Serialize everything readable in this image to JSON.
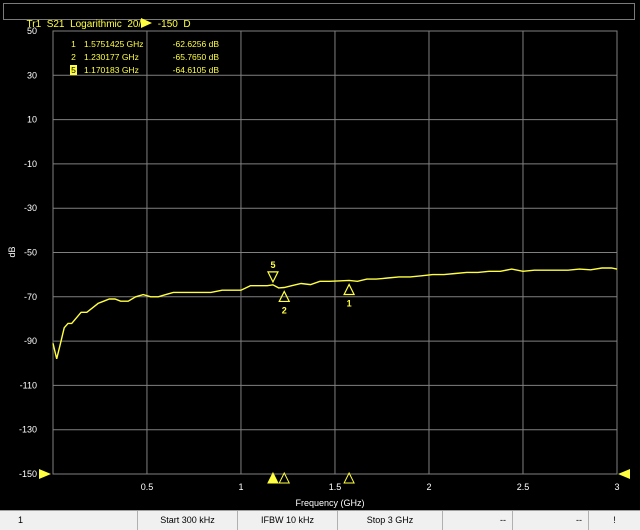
{
  "trace": {
    "name": "Tr1",
    "measurement": "S21",
    "format": "Logarithmic",
    "scale_div": "20",
    "reference": "-150",
    "d_label": "D"
  },
  "marker_table": [
    {
      "index": "1",
      "freq": "1.5751425 GHz",
      "value": "-62.6256 dB",
      "active": false
    },
    {
      "index": "2",
      "freq": "1.230177 GHz",
      "value": "-65.7650 dB",
      "active": false
    },
    {
      "index": "5",
      "freq": "1.170183 GHz",
      "value": "-64.6105 dB",
      "active": true
    }
  ],
  "status_bar": {
    "channel": "1",
    "start": "Start 300 kHz",
    "ifbw": "IFBW 10 kHz",
    "stop": "Stop 3 GHz",
    "field1": "--",
    "field2": "--",
    "field3": "!"
  },
  "colors": {
    "trace": "#ffff40",
    "grid": "#808080",
    "background": "#000000"
  },
  "chart_data": {
    "type": "line",
    "title": "",
    "xlabel": "Frequency (GHz)",
    "ylabel": "dB",
    "xlim": [
      0.0003,
      3
    ],
    "ylim": [
      -150,
      50
    ],
    "x_ticks": [
      0.5,
      1,
      1.5,
      2,
      2.5,
      3
    ],
    "x_tick_labels": [
      "0.5",
      "1",
      "1.5",
      "2",
      "2.5",
      "3"
    ],
    "y_ticks": [
      50,
      30,
      10,
      -10,
      -30,
      -50,
      -70,
      -90,
      -110,
      -130,
      -150
    ],
    "y_tick_labels": [
      "50",
      "30",
      "10",
      "-10",
      "-30",
      "-50",
      "-70",
      "-90",
      "-110",
      "-130",
      "-150"
    ],
    "grid": true,
    "series": [
      {
        "x": [
          0.0003,
          0.02,
          0.04,
          0.06,
          0.08,
          0.1,
          0.12,
          0.15,
          0.18,
          0.21,
          0.24,
          0.27,
          0.3,
          0.33,
          0.36,
          0.4,
          0.44,
          0.48,
          0.52,
          0.56,
          0.6,
          0.64,
          0.68,
          0.72,
          0.78,
          0.84,
          0.9,
          0.96,
          1.0,
          1.05,
          1.1,
          1.14,
          1.17,
          1.2,
          1.23,
          1.27,
          1.32,
          1.37,
          1.42,
          1.47,
          1.52,
          1.575,
          1.62,
          1.67,
          1.72,
          1.78,
          1.84,
          1.9,
          1.96,
          2.02,
          2.08,
          2.14,
          2.2,
          2.26,
          2.32,
          2.38,
          2.44,
          2.5,
          2.56,
          2.62,
          2.68,
          2.74,
          2.8,
          2.86,
          2.92,
          2.97,
          3.0
        ],
        "y": [
          -91,
          -98,
          -91,
          -84,
          -82,
          -82,
          -80,
          -77,
          -77,
          -75,
          -73,
          -72,
          -71,
          -71,
          -72,
          -72,
          -70,
          -69,
          -70,
          -70,
          -69,
          -68,
          -68,
          -68,
          -68,
          -68,
          -67,
          -67,
          -67,
          -65,
          -65,
          -65,
          -64.6,
          -66,
          -65.8,
          -65,
          -64,
          -64.5,
          -63,
          -63,
          -62.8,
          -62.6,
          -63,
          -62,
          -62,
          -61.5,
          -61,
          -61,
          -60.5,
          -60,
          -60,
          -59.5,
          -59,
          -59,
          -58.5,
          -58.5,
          -57.5,
          -58.5,
          -58,
          -58,
          -58,
          -58,
          -57.5,
          -57.8,
          -57,
          -57,
          -57.5
        ]
      }
    ],
    "markers": [
      {
        "label": "1",
        "x": 1.5751425,
        "y": -62.6256,
        "orientation": "up",
        "active": false
      },
      {
        "label": "2",
        "x": 1.230177,
        "y": -65.765,
        "orientation": "up",
        "active": false
      },
      {
        "label": "5",
        "x": 1.170183,
        "y": -64.6105,
        "orientation": "down",
        "active": true
      }
    ],
    "reference_level": -150
  }
}
